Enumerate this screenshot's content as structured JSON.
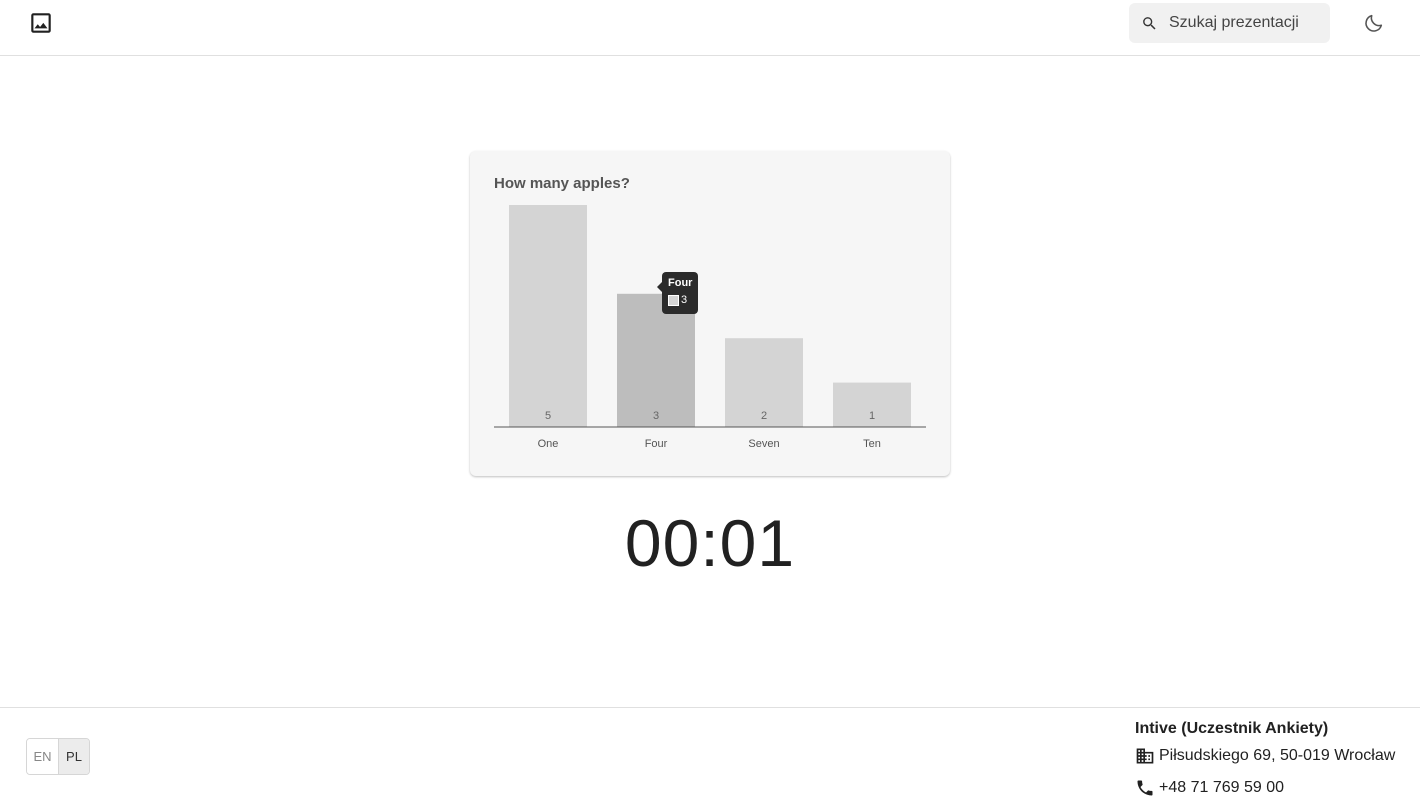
{
  "header": {
    "search_placeholder": "Szukaj prezentacji",
    "icons": {
      "logo": "image-icon",
      "search": "search-icon",
      "theme": "moon-icon"
    }
  },
  "chart_data": {
    "type": "bar",
    "title": "How many apples?",
    "categories": [
      "One",
      "Four",
      "Seven",
      "Ten"
    ],
    "values": [
      5,
      3,
      2,
      1
    ],
    "ylim": [
      0,
      5
    ],
    "grid": false,
    "legend": "none",
    "colors": {
      "bar": "#d4d4d4",
      "bar_hover": "#bdbdbd"
    },
    "tooltip": {
      "category": "Four",
      "value": "3"
    }
  },
  "timer": {
    "value": "00:01"
  },
  "footer": {
    "languages": [
      "EN",
      "PL"
    ],
    "active_language": "PL",
    "company": "Intive (Uczestnik Ankiety)",
    "address": "Piłsudskiego 69, 50-019 Wrocław",
    "phone": "+48 71 769 59 00"
  }
}
